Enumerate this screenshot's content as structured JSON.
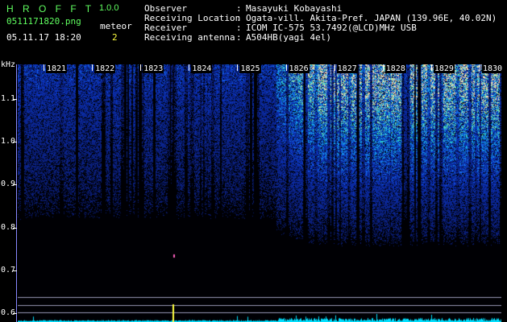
{
  "app": {
    "name": "H R O F F T",
    "version": "1.0.0"
  },
  "file_name": "0511171820.png",
  "datetime": "05.11.17 18:20",
  "meteor": {
    "label": "meteor",
    "count": "2"
  },
  "info": [
    {
      "label": "Observer",
      "value": "Masayuki Kobayashi"
    },
    {
      "label": "Receiving Location",
      "value": "Ogata-vill. Akita-Pref. JAPAN (139.96E, 40.02N)"
    },
    {
      "label": "Receiver",
      "value": "ICOM IC-575 53.7492(@LCD)MHz USB"
    },
    {
      "label": "Receiving antenna",
      "value": "A504HB(yagi 4el)"
    }
  ],
  "colors": {
    "title": "#60ff60",
    "text": "#ffffff",
    "meteor_count": "#ffff40",
    "signal_low": "#0a1460",
    "signal_mid": "#2060ff",
    "signal_high": "#60ffc0",
    "baseline": "#00e0ff"
  },
  "chart_data": {
    "type": "heatmap",
    "x_ticks": [
      "1821",
      "1822",
      "1823",
      "1824",
      "1825",
      "1826",
      "1827",
      "1828",
      "1829",
      "1830"
    ],
    "y_unit": "kHz",
    "y_ticks": [
      "1.1",
      "1.0",
      "0.9",
      "0.8",
      "0.7",
      "0.6"
    ],
    "y_range": [
      0.58,
      1.18
    ],
    "meteor_freq_khz": 0.72
  }
}
